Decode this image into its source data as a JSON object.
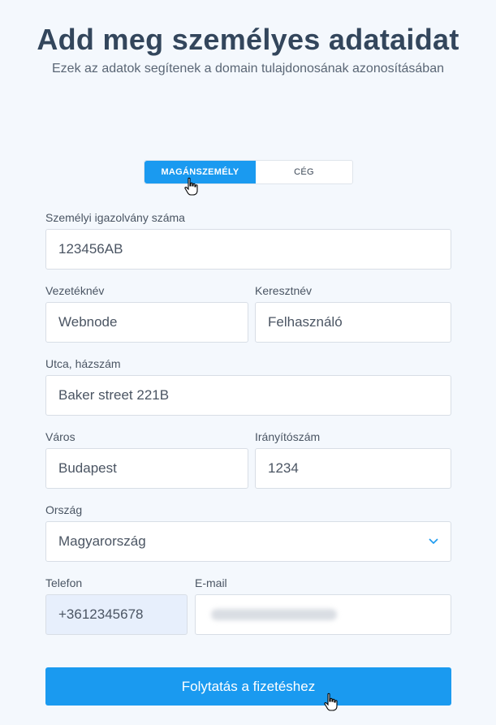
{
  "header": {
    "title": "Add meg személyes adataidat",
    "subtitle": "Ezek az adatok segítenek a domain tulajdonosának azonosításában"
  },
  "toggle": {
    "options": [
      "MAGÁNSZEMÉLY",
      "CÉG"
    ],
    "selected": "MAGÁNSZEMÉLY"
  },
  "form": {
    "id_number": {
      "label": "Személyi igazolvány száma",
      "value": "123456AB"
    },
    "last_name": {
      "label": "Vezetéknév",
      "value": "Webnode"
    },
    "first_name": {
      "label": "Keresztnév",
      "value": "Felhasználó"
    },
    "street": {
      "label": "Utca, házszám",
      "value": "Baker street 221B"
    },
    "city": {
      "label": "Város",
      "value": "Budapest"
    },
    "zip": {
      "label": "Irányítószám",
      "value": "1234"
    },
    "country": {
      "label": "Ország",
      "value": "Magyarország"
    },
    "phone": {
      "label": "Telefon",
      "value": "+3612345678"
    },
    "email": {
      "label": "E-mail",
      "value": ""
    }
  },
  "submit_label": "Folytatás a fizetéshez",
  "colors": {
    "accent": "#1a9af0",
    "background": "#f4f8fd",
    "title": "#33465c"
  },
  "icons": [
    "chevron-down-icon",
    "hand-pointer-cursor-icon"
  ]
}
